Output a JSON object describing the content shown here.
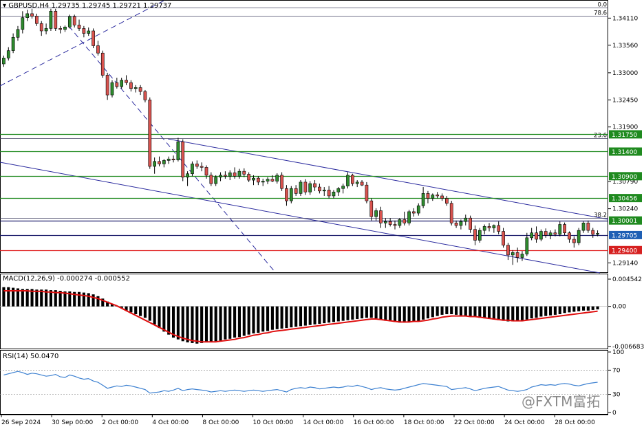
{
  "header": {
    "symbol_line": "GBPUSD,H4  1.29735 1.29745 1.29721 1.29737",
    "macd_label": "MACD(12,26,9) -0.000274 -0.000552",
    "rsi_label": "RSI(14) 50.0470"
  },
  "watermark": "@FXTM富拓",
  "colors": {
    "bull": "#2e8b2e",
    "bear": "#d9534f",
    "green_line": "#1f8a1f",
    "red_line": "#e02020",
    "navy": "#2a2a6e",
    "macd_bar": "#000000",
    "signal": "#e01010",
    "rsi": "#3a7fd0"
  },
  "chart_data": {
    "type": "candlestick",
    "price_axis": {
      "ylim": [
        1.2895,
        1.3445
      ],
      "ticks": [
        "1.34110",
        "1.33560",
        "1.33000",
        "1.32450",
        "1.31900",
        "1.30790",
        "1.30240",
        "1.29140"
      ],
      "tick_values": [
        1.3411,
        1.3356,
        1.33,
        1.3245,
        1.319,
        1.3079,
        1.3024,
        1.2914
      ]
    },
    "x_ticks": [
      "26 Sep 2024",
      "30 Sep 00:00",
      "2 Oct 00:00",
      "4 Oct 00:00",
      "8 Oct 00:00",
      "10 Oct 00:00",
      "14 Oct 00:00",
      "16 Oct 00:00",
      "18 Oct 00:00",
      "22 Oct 00:00",
      "24 Oct 00:00",
      "28 Oct 00:00"
    ],
    "level_lines": [
      {
        "label": "1.31750",
        "value": 1.3175,
        "color": "#1f8a1f",
        "tag_bg": "#1f8a1f"
      },
      {
        "label": "1.31400",
        "value": 1.314,
        "color": "#1f8a1f",
        "tag_bg": "#1f8a1f"
      },
      {
        "label": "1.30900",
        "value": 1.309,
        "color": "#1f8a1f",
        "tag_bg": "#1f8a1f"
      },
      {
        "label": "1.30456",
        "value": 1.30456,
        "color": "#1f8a1f",
        "tag_bg": "#1f8a1f"
      },
      {
        "label": "1.30001",
        "value": 1.30001,
        "color": "#1a1a6a",
        "tag_bg": "#1f8a1f"
      },
      {
        "label": "1.29705",
        "value": 1.29705,
        "color": "#1a1a6a",
        "tag_bg": "#1e5fb4"
      },
      {
        "label": "1.29400",
        "value": 1.294,
        "color": "#e02020",
        "tag_bg": "#d62020"
      }
    ],
    "fib_levels": [
      {
        "label": "0.0",
        "value": 1.3432
      },
      {
        "label": "78.6",
        "value": 1.3415
      },
      {
        "label": "23.6",
        "value": 1.3167
      },
      {
        "label": "38.2",
        "value": 1.3005
      }
    ],
    "candles": [
      [
        1.3318,
        1.3335,
        1.3312,
        1.333
      ],
      [
        1.333,
        1.3352,
        1.3325,
        1.3345
      ],
      [
        1.3345,
        1.338,
        1.334,
        1.3372
      ],
      [
        1.3372,
        1.3395,
        1.3365,
        1.3388
      ],
      [
        1.3388,
        1.3425,
        1.338,
        1.3412
      ],
      [
        1.3412,
        1.3428,
        1.3405,
        1.342
      ],
      [
        1.342,
        1.343,
        1.341,
        1.3415
      ],
      [
        1.3415,
        1.342,
        1.3395,
        1.34
      ],
      [
        1.34,
        1.3405,
        1.3375,
        1.3385
      ],
      [
        1.3385,
        1.34,
        1.3378,
        1.339
      ],
      [
        1.339,
        1.343,
        1.3385,
        1.3425
      ],
      [
        1.3425,
        1.343,
        1.3385,
        1.339
      ],
      [
        1.339,
        1.3395,
        1.338,
        1.3388
      ],
      [
        1.3388,
        1.3396,
        1.3383,
        1.3393
      ],
      [
        1.3393,
        1.3418,
        1.339,
        1.3414
      ],
      [
        1.3414,
        1.3418,
        1.3392,
        1.3397
      ],
      [
        1.3397,
        1.3408,
        1.3385,
        1.339
      ],
      [
        1.339,
        1.3395,
        1.3372,
        1.338
      ],
      [
        1.338,
        1.3392,
        1.3375,
        1.3385
      ],
      [
        1.3385,
        1.339,
        1.335,
        1.3355
      ],
      [
        1.3355,
        1.3365,
        1.3335,
        1.334
      ],
      [
        1.334,
        1.3345,
        1.329,
        1.3295
      ],
      [
        1.3295,
        1.33,
        1.3245,
        1.3255
      ],
      [
        1.3255,
        1.3285,
        1.325,
        1.328
      ],
      [
        1.328,
        1.329,
        1.3268,
        1.3272
      ],
      [
        1.3272,
        1.329,
        1.3268,
        1.3285
      ],
      [
        1.3285,
        1.3295,
        1.3275,
        1.328
      ],
      [
        1.328,
        1.3285,
        1.3262,
        1.3268
      ],
      [
        1.3268,
        1.3275,
        1.326,
        1.327
      ],
      [
        1.327,
        1.3275,
        1.3255,
        1.3262
      ],
      [
        1.3262,
        1.3265,
        1.324,
        1.3245
      ],
      [
        1.3245,
        1.325,
        1.3105,
        1.311
      ],
      [
        1.311,
        1.3128,
        1.3095,
        1.312
      ],
      [
        1.312,
        1.313,
        1.311,
        1.3115
      ],
      [
        1.3115,
        1.3125,
        1.3108,
        1.3122
      ],
      [
        1.3122,
        1.313,
        1.3115,
        1.3125
      ],
      [
        1.3125,
        1.3132,
        1.3118,
        1.3123
      ],
      [
        1.3123,
        1.3168,
        1.312,
        1.316
      ],
      [
        1.316,
        1.3165,
        1.308,
        1.3088
      ],
      [
        1.3088,
        1.31,
        1.307,
        1.3095
      ],
      [
        1.3095,
        1.312,
        1.309,
        1.3115
      ],
      [
        1.3115,
        1.3122,
        1.3105,
        1.311
      ],
      [
        1.311,
        1.3118,
        1.31,
        1.3108
      ],
      [
        1.3108,
        1.3112,
        1.3085,
        1.3092
      ],
      [
        1.3092,
        1.3098,
        1.307,
        1.3075
      ],
      [
        1.3075,
        1.3092,
        1.307,
        1.3088
      ],
      [
        1.3088,
        1.3098,
        1.308,
        1.3092
      ],
      [
        1.3092,
        1.31,
        1.3085,
        1.309
      ],
      [
        1.309,
        1.3102,
        1.3082,
        1.3097
      ],
      [
        1.3097,
        1.3108,
        1.3085,
        1.309
      ],
      [
        1.309,
        1.3105,
        1.3085,
        1.31
      ],
      [
        1.31,
        1.3106,
        1.3088,
        1.3094
      ],
      [
        1.3094,
        1.3098,
        1.3078,
        1.3082
      ],
      [
        1.3082,
        1.3092,
        1.3072,
        1.3086
      ],
      [
        1.3086,
        1.309,
        1.3072,
        1.3078
      ],
      [
        1.3078,
        1.3085,
        1.307,
        1.308
      ],
      [
        1.308,
        1.3088,
        1.3074,
        1.3084
      ],
      [
        1.3084,
        1.3092,
        1.3078,
        1.308
      ],
      [
        1.308,
        1.3096,
        1.3075,
        1.3092
      ],
      [
        1.3092,
        1.3098,
        1.306,
        1.3065
      ],
      [
        1.3065,
        1.3072,
        1.303,
        1.304
      ],
      [
        1.304,
        1.307,
        1.3035,
        1.3065
      ],
      [
        1.3065,
        1.3072,
        1.305,
        1.3055
      ],
      [
        1.3055,
        1.3082,
        1.305,
        1.3078
      ],
      [
        1.3078,
        1.3084,
        1.3052,
        1.3058
      ],
      [
        1.3058,
        1.308,
        1.3052,
        1.3075
      ],
      [
        1.3075,
        1.3082,
        1.306,
        1.3068
      ],
      [
        1.3068,
        1.3075,
        1.3055,
        1.306
      ],
      [
        1.306,
        1.3068,
        1.305,
        1.3062
      ],
      [
        1.3062,
        1.307,
        1.3045,
        1.305
      ],
      [
        1.305,
        1.3062,
        1.3045,
        1.3058
      ],
      [
        1.3058,
        1.3068,
        1.305,
        1.3065
      ],
      [
        1.3065,
        1.3075,
        1.3055,
        1.307
      ],
      [
        1.307,
        1.3098,
        1.3065,
        1.3092
      ],
      [
        1.3092,
        1.3095,
        1.307,
        1.3075
      ],
      [
        1.3075,
        1.3082,
        1.3068,
        1.3078
      ],
      [
        1.3078,
        1.3082,
        1.307,
        1.3072
      ],
      [
        1.3072,
        1.3078,
        1.3035,
        1.304
      ],
      [
        1.304,
        1.3045,
        1.3,
        1.3008
      ],
      [
        1.3008,
        1.3025,
        1.3,
        1.302
      ],
      [
        1.302,
        1.3028,
        1.2985,
        1.2995
      ],
      [
        1.2995,
        1.3005,
        1.2985,
        1.2998
      ],
      [
        1.2998,
        1.3005,
        1.2988,
        1.2992
      ],
      [
        1.2992,
        1.3,
        1.2982,
        1.299
      ],
      [
        1.299,
        1.3005,
        1.2985,
        1.3002
      ],
      [
        1.3002,
        1.3018,
        1.299,
        1.2995
      ],
      [
        1.2995,
        1.3022,
        1.299,
        1.3018
      ],
      [
        1.3018,
        1.3025,
        1.3008,
        1.3015
      ],
      [
        1.3015,
        1.3035,
        1.301,
        1.303
      ],
      [
        1.303,
        1.3068,
        1.3025,
        1.3055
      ],
      [
        1.3055,
        1.306,
        1.3035,
        1.3045
      ],
      [
        1.3045,
        1.3055,
        1.304,
        1.3052
      ],
      [
        1.3052,
        1.3058,
        1.3045,
        1.305
      ],
      [
        1.305,
        1.3055,
        1.304,
        1.3045
      ],
      [
        1.3045,
        1.305,
        1.303,
        1.3035
      ],
      [
        1.3035,
        1.304,
        1.299,
        1.2995
      ],
      [
        1.2995,
        1.3,
        1.2985,
        1.299
      ],
      [
        1.299,
        1.3002,
        1.2982,
        1.2998
      ],
      [
        1.2998,
        1.3012,
        1.299,
        1.3005
      ],
      [
        1.3005,
        1.301,
        1.2975,
        1.2982
      ],
      [
        1.2982,
        1.299,
        1.295,
        1.296
      ],
      [
        1.296,
        1.2985,
        1.2955,
        1.298
      ],
      [
        1.298,
        1.2992,
        1.2972,
        1.2988
      ],
      [
        1.2988,
        1.2995,
        1.2978,
        1.2985
      ],
      [
        1.2985,
        1.2992,
        1.2975,
        1.299
      ],
      [
        1.299,
        1.2998,
        1.2972,
        1.2978
      ],
      [
        1.2978,
        1.2985,
        1.2945,
        1.295
      ],
      [
        1.295,
        1.2955,
        1.292,
        1.293
      ],
      [
        1.293,
        1.294,
        1.291,
        1.2935
      ],
      [
        1.2935,
        1.2945,
        1.2915,
        1.2925
      ],
      [
        1.2925,
        1.2938,
        1.2918,
        1.2932
      ],
      [
        1.2932,
        1.2975,
        1.2928,
        1.2965
      ],
      [
        1.2965,
        1.2985,
        1.296,
        1.2975
      ],
      [
        1.2975,
        1.2988,
        1.2955,
        1.2962
      ],
      [
        1.2962,
        1.2982,
        1.2958,
        1.2978
      ],
      [
        1.2978,
        1.2984,
        1.2965,
        1.297
      ],
      [
        1.297,
        1.298,
        1.2962,
        1.2975
      ],
      [
        1.2975,
        1.2982,
        1.2968,
        1.2972
      ],
      [
        1.2972,
        1.2998,
        1.2968,
        1.2992
      ],
      [
        1.2992,
        1.2996,
        1.297,
        1.2975
      ],
      [
        1.2975,
        1.2978,
        1.2955,
        1.2962
      ],
      [
        1.2962,
        1.2968,
        1.2945,
        1.2955
      ],
      [
        1.2955,
        1.2985,
        1.295,
        1.298
      ],
      [
        1.298,
        1.2998,
        1.2975,
        1.2995
      ],
      [
        1.2995,
        1.3,
        1.2975,
        1.298
      ],
      [
        1.298,
        1.2985,
        1.2965,
        1.2972
      ],
      [
        1.2972,
        1.298,
        1.2968,
        1.2974
      ]
    ],
    "macd_axis": {
      "ticks": [
        "0.004542",
        "0.00",
        "-0.006683"
      ],
      "tick_values": [
        0.004542,
        0.0,
        -0.006683
      ]
    },
    "macd": [
      0.0032,
      0.0032,
      0.0031,
      0.003,
      0.0029,
      0.0029,
      0.0029,
      0.0028,
      0.0028,
      0.0028,
      0.0027,
      0.0027,
      0.0026,
      0.0025,
      0.0025,
      0.0024,
      0.0024,
      0.0023,
      0.0022,
      0.002,
      0.0017,
      0.0013,
      0.0008,
      0.0004,
      0.0001,
      -0.0003,
      -0.0007,
      -0.001,
      -0.0013,
      -0.0016,
      -0.0019,
      -0.0024,
      -0.003,
      -0.0036,
      -0.0042,
      -0.0047,
      -0.0052,
      -0.0055,
      -0.0058,
      -0.006,
      -0.0061,
      -0.0062,
      -0.0061,
      -0.006,
      -0.0059,
      -0.0058,
      -0.0057,
      -0.0055,
      -0.0054,
      -0.0052,
      -0.0051,
      -0.0049,
      -0.0047,
      -0.0045,
      -0.0044,
      -0.0042,
      -0.0041,
      -0.0039,
      -0.0038,
      -0.0037,
      -0.0036,
      -0.0035,
      -0.0034,
      -0.0033,
      -0.0032,
      -0.0031,
      -0.003,
      -0.0029,
      -0.0028,
      -0.0027,
      -0.0026,
      -0.0025,
      -0.0024,
      -0.0023,
      -0.0022,
      -0.0021,
      -0.002,
      -0.0019,
      -0.0019,
      -0.002,
      -0.0022,
      -0.0024,
      -0.0025,
      -0.0026,
      -0.0027,
      -0.0027,
      -0.0026,
      -0.0025,
      -0.0024,
      -0.0022,
      -0.002,
      -0.0018,
      -0.0016,
      -0.0014,
      -0.0013,
      -0.0013,
      -0.0014,
      -0.0015,
      -0.0016,
      -0.0017,
      -0.0018,
      -0.0019,
      -0.002,
      -0.0021,
      -0.0022,
      -0.0023,
      -0.0024,
      -0.0025,
      -0.0025,
      -0.0024,
      -0.0023,
      -0.0022,
      -0.002,
      -0.0019,
      -0.0017,
      -0.0016,
      -0.0015,
      -0.0014,
      -0.0013,
      -0.0011,
      -0.001,
      -0.0009,
      -0.0008,
      -0.0007,
      -0.0007,
      -0.0006,
      -0.0005
    ],
    "signal": [
      0.0026,
      0.0026,
      0.0026,
      0.0026,
      0.0026,
      0.0026,
      0.0025,
      0.0025,
      0.0025,
      0.0024,
      0.0024,
      0.0023,
      0.0023,
      0.0022,
      0.0021,
      0.002,
      0.0019,
      0.0018,
      0.0017,
      0.0015,
      0.0013,
      0.001,
      0.0007,
      0.0004,
      0.0001,
      -0.0003,
      -0.0007,
      -0.0011,
      -0.0015,
      -0.0019,
      -0.0023,
      -0.0027,
      -0.0031,
      -0.0035,
      -0.0039,
      -0.0043,
      -0.0047,
      -0.005,
      -0.0053,
      -0.0055,
      -0.0057,
      -0.0058,
      -0.0059,
      -0.0059,
      -0.0059,
      -0.0059,
      -0.0058,
      -0.0057,
      -0.0056,
      -0.0055,
      -0.0053,
      -0.0052,
      -0.005,
      -0.0048,
      -0.0047,
      -0.0045,
      -0.0044,
      -0.0042,
      -0.0041,
      -0.004,
      -0.0039,
      -0.0038,
      -0.0037,
      -0.0036,
      -0.0035,
      -0.0034,
      -0.0033,
      -0.0032,
      -0.0031,
      -0.003,
      -0.0029,
      -0.0028,
      -0.0027,
      -0.0026,
      -0.0025,
      -0.0024,
      -0.0023,
      -0.0022,
      -0.0021,
      -0.0021,
      -0.0022,
      -0.0023,
      -0.0024,
      -0.0025,
      -0.0026,
      -0.0026,
      -0.0026,
      -0.0025,
      -0.0025,
      -0.0024,
      -0.0023,
      -0.0021,
      -0.002,
      -0.0018,
      -0.0017,
      -0.0016,
      -0.0016,
      -0.0016,
      -0.0016,
      -0.0017,
      -0.0017,
      -0.0018,
      -0.0019,
      -0.002,
      -0.0021,
      -0.0022,
      -0.0023,
      -0.0023,
      -0.0024,
      -0.0024,
      -0.0024,
      -0.0023,
      -0.0022,
      -0.0021,
      -0.002,
      -0.0019,
      -0.0018,
      -0.0017,
      -0.0016,
      -0.0015,
      -0.0014,
      -0.0013,
      -0.0012,
      -0.0011,
      -0.001,
      -0.0009,
      -0.0008
    ],
    "rsi_axis": {
      "ticks": [
        "100",
        "70",
        "30",
        "0"
      ],
      "tick_values": [
        100,
        70,
        30,
        0
      ],
      "levels": [
        70,
        30
      ]
    },
    "rsi": [
      62,
      64,
      66,
      68,
      66,
      63,
      65,
      64,
      62,
      60,
      61,
      63,
      59,
      58,
      62,
      60,
      57,
      55,
      56,
      52,
      50,
      45,
      40,
      42,
      44,
      43,
      45,
      44,
      42,
      40,
      38,
      32,
      33,
      34,
      36,
      35,
      37,
      40,
      36,
      38,
      39,
      38,
      37,
      36,
      34,
      35,
      36,
      35,
      36,
      37,
      36,
      35,
      36,
      37,
      36,
      35,
      36,
      37,
      38,
      36,
      34,
      38,
      40,
      41,
      40,
      42,
      41,
      39,
      40,
      41,
      42,
      41,
      42,
      44,
      43,
      45,
      43,
      41,
      38,
      40,
      41,
      39,
      38,
      37,
      38,
      40,
      42,
      44,
      46,
      48,
      47,
      46,
      45,
      44,
      43,
      38,
      39,
      40,
      41,
      39,
      36,
      38,
      40,
      41,
      42,
      43,
      40,
      37,
      36,
      35,
      36,
      38,
      42,
      44,
      46,
      45,
      46,
      45,
      47,
      48,
      47,
      45,
      44,
      46,
      48,
      49,
      50
    ]
  }
}
